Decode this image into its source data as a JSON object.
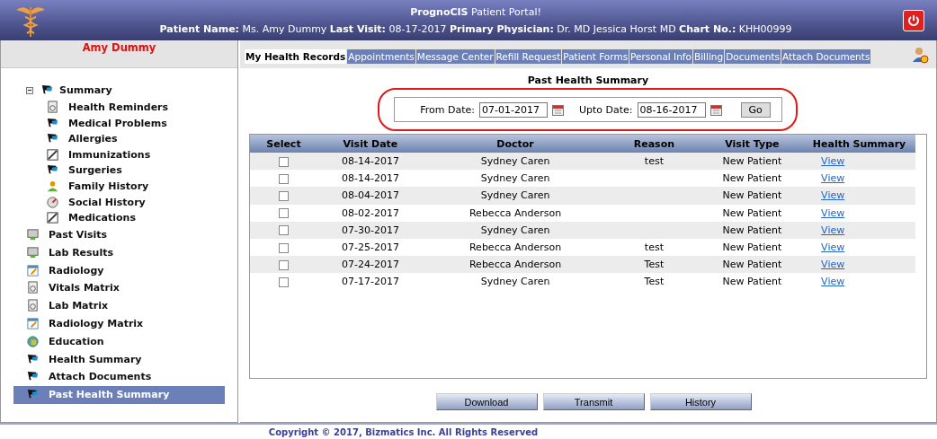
{
  "header": {
    "title": "**PrognoCIS** Patient Portal!",
    "info": "**Patient Name:** Ms. Amy Dummy **Last Visit:** 08-17-2017 **Primary Physician:** Dr. MD Jessica Horst MD **Chart No.:** KHH00999"
  },
  "sidebar": {
    "patient_name": "Amy Dummy",
    "items": [
      {
        "label": "Summary",
        "selected": false,
        "expanded": true,
        "children": [
          {
            "label": "Health Reminders",
            "selected": false
          },
          {
            "label": "Medical Problems",
            "selected": false
          },
          {
            "label": "Allergies",
            "selected": false
          },
          {
            "label": "Immunizations",
            "selected": false
          },
          {
            "label": "Surgeries",
            "selected": false
          },
          {
            "label": "Family History",
            "selected": false
          },
          {
            "label": "Social History",
            "selected": false
          },
          {
            "label": "Medications",
            "selected": false
          }
        ]
      },
      {
        "label": "Past Visits",
        "selected": false
      },
      {
        "label": "Lab Results",
        "selected": false
      },
      {
        "label": "Radiology",
        "selected": false
      },
      {
        "label": "Vitals Matrix",
        "selected": false
      },
      {
        "label": "Lab Matrix",
        "selected": false
      },
      {
        "label": "Radiology Matrix",
        "selected": false
      },
      {
        "label": "Education",
        "selected": false
      },
      {
        "label": "Health Summary",
        "selected": false
      },
      {
        "label": "Attach Documents",
        "selected": false
      },
      {
        "label": "Past Health Summary",
        "selected": true
      }
    ]
  },
  "tabs": [
    {
      "label": "My Health Records",
      "selected": true
    },
    {
      "label": "Appointments",
      "selected": false
    },
    {
      "label": "Message Center",
      "selected": false
    },
    {
      "label": "Refill Request",
      "selected": false
    },
    {
      "label": "Patient Forms",
      "selected": false
    },
    {
      "label": "Personal Info",
      "selected": false
    },
    {
      "label": "Billing",
      "selected": false
    },
    {
      "label": "Documents",
      "selected": false
    },
    {
      "label": "Attach Documents",
      "selected": false
    }
  ],
  "section_title": "Past Health Summary",
  "filter": {
    "from_label": "From Date:",
    "from_value": "07-01-2017",
    "upto_label": "Upto Date:",
    "upto_value": "08-16-2017",
    "go": "Go"
  },
  "table": {
    "columns": [
      "Select",
      "Visit Date",
      "Doctor",
      "Reason",
      "Visit Type",
      "Health Summary"
    ],
    "rows": [
      {
        "checked": false,
        "visit_date": "08-14-2017",
        "doctor": "Sydney Caren",
        "reason": "test",
        "visit_type": "New Patient",
        "link": "View"
      },
      {
        "checked": false,
        "visit_date": "08-14-2017",
        "doctor": "Sydney Caren",
        "visit_type": "New Patient",
        "link": "View"
      },
      {
        "checked": false,
        "visit_date": "08-04-2017",
        "doctor": "Sydney Caren",
        "visit_type": "New Patient",
        "link": "View"
      },
      {
        "checked": false,
        "visit_date": "08-02-2017",
        "doctor": "Rebecca Anderson",
        "visit_type": "New Patient",
        "link": "View"
      },
      {
        "checked": false,
        "visit_date": "07-30-2017",
        "doctor": "Sydney Caren",
        "visit_type": "New Patient",
        "link": "View"
      },
      {
        "checked": false,
        "visit_date": "07-25-2017",
        "doctor": "Rebecca Anderson",
        "reason": "test",
        "visit_type": "New Patient",
        "link": "View"
      },
      {
        "checked": false,
        "visit_date": "07-24-2017",
        "doctor": "Rebecca Anderson",
        "reason": "Test",
        "visit_type": "New Patient",
        "link": "View"
      },
      {
        "checked": false,
        "visit_date": "07-17-2017",
        "doctor": "Sydney Caren",
        "reason": "Test",
        "visit_type": "New Patient",
        "link": "View"
      }
    ]
  },
  "buttons": [
    "Download",
    "Transmit",
    "History"
  ],
  "footer": "Copyright © 2017, Bizmatics Inc. All Rights Reserved"
}
